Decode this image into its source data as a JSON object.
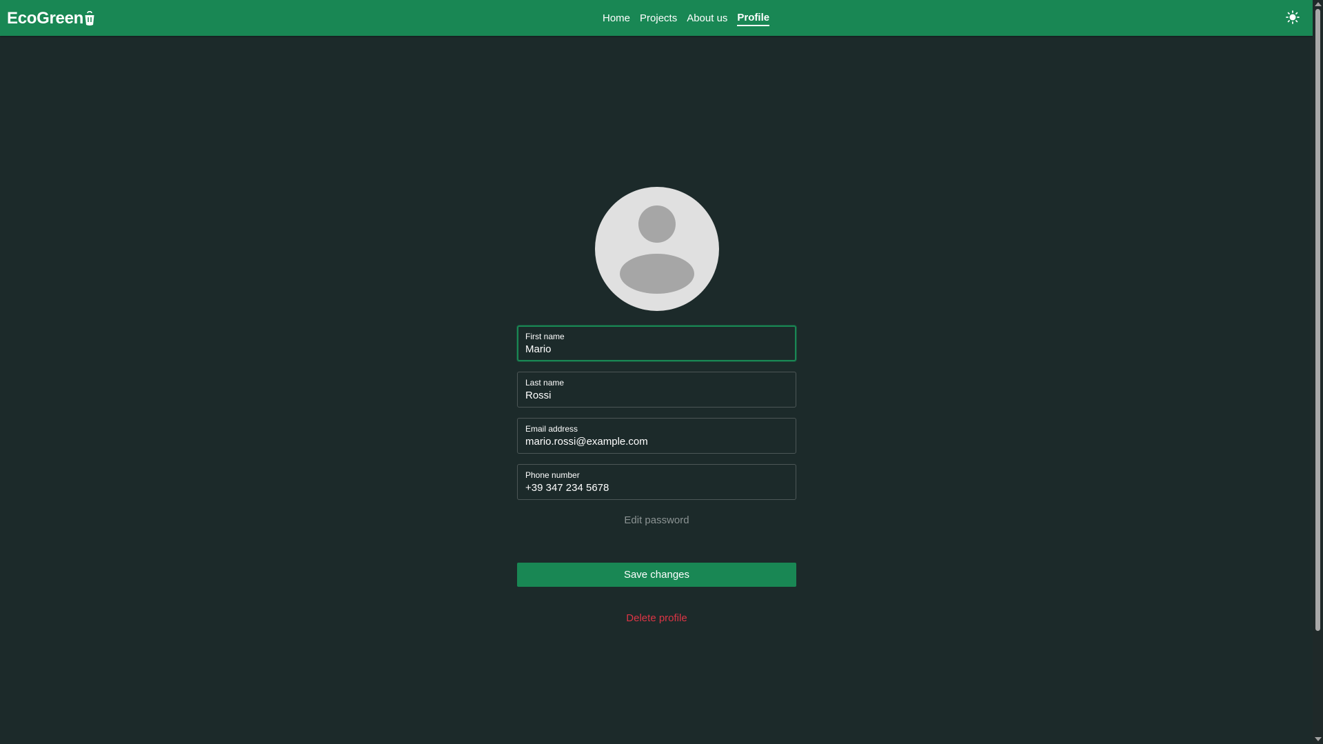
{
  "app": {
    "brand": "EcoGreen",
    "accent_color": "#198754",
    "background_color": "#1c2a2a",
    "danger_color": "#dc3545"
  },
  "nav": {
    "links": [
      {
        "label": "Home",
        "active": false
      },
      {
        "label": "Projects",
        "active": false
      },
      {
        "label": "About us",
        "active": false
      },
      {
        "label": "Profile",
        "active": true
      }
    ],
    "theme_toggle_icon": "sun-icon"
  },
  "profile": {
    "avatar_icon": "user-avatar-icon",
    "fields": [
      {
        "label": "First name",
        "value": "Mario",
        "focused": true
      },
      {
        "label": "Last name",
        "value": "Rossi",
        "focused": false
      },
      {
        "label": "Email address",
        "value": "mario.rossi@example.com",
        "focused": false
      },
      {
        "label": "Phone number",
        "value": "+39 347 234 5678",
        "focused": false
      }
    ],
    "edit_password_label": "Edit password",
    "save_label": "Save changes",
    "delete_label": "Delete profile"
  }
}
